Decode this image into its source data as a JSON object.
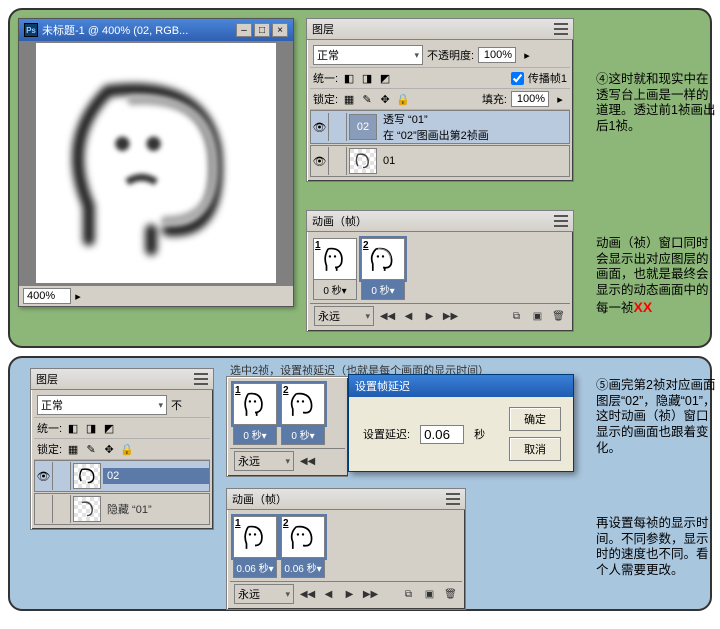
{
  "doc": {
    "title": "未标题-1 @ 400% (02, RGB...",
    "zoom": "400%",
    "ps": "Ps"
  },
  "winbtns": {
    "min": "–",
    "max": "□",
    "close": "×"
  },
  "layers": {
    "title": "图层",
    "mode": "正常",
    "opacity_label": "不透明度:",
    "opacity": "100%",
    "unify_label": "统一:",
    "propagate": "传播帧1",
    "lock_label": "锁定:",
    "fill_label": "填充:",
    "fill": "100%",
    "layer02": "02",
    "layer02_desc1": "透写 “01”",
    "layer02_desc2": "在 “02”图画出第2祯画",
    "layer01": "01",
    "hide01": "隐藏 “01”"
  },
  "anim": {
    "title": "动画（帧）",
    "forever": "永远",
    "chev": "▾",
    "t0": "0 秒",
    "t006": "0.06 秒"
  },
  "caption": "选中2祯，设置祯延迟（也就是每个画面的显示时间）",
  "dialog": {
    "title": "设置帧延迟",
    "label": "设置延迟:",
    "value": "0.06",
    "unit": "秒",
    "ok": "确定",
    "cancel": "取消"
  },
  "annot": {
    "a4": "④这时就和现实中在透写台上画是一样的道理。透过前1祯画出后1祯。",
    "a_anim": "动画（祯）窗口同时会显示出对应图层的画面，也就是最终会显示的动态画面中的每一祯",
    "xx": "XX",
    "a5": "⑤画完第2祯对应画面图层“02”，隐藏“01”，这时动画（祯）窗口显示的画面也跟着变化。",
    "a_time": "再设置每祯的显示时间。不同参数，显示时的速度也不同。看个人需要更改。"
  },
  "ctrl": {
    "prev2": "◀◀",
    "prev": "◀",
    "play": "▶",
    "next": "▶▶",
    "f1": "1",
    "f2": "2"
  },
  "mode_abbr": "不"
}
